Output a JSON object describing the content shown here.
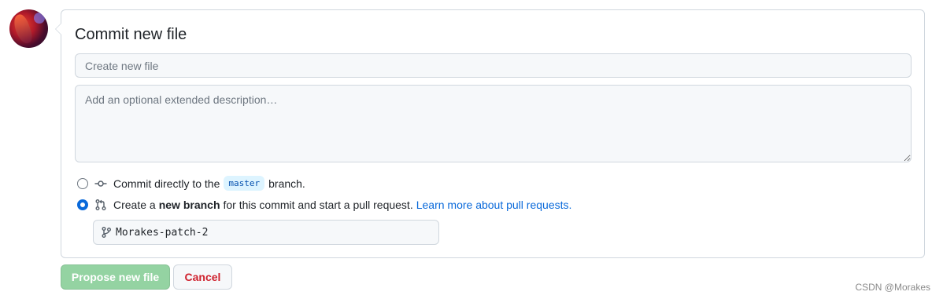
{
  "form": {
    "title": "Commit new file",
    "summary_placeholder": "Create new file",
    "summary_value": "",
    "description_placeholder": "Add an optional extended description…",
    "description_value": ""
  },
  "options": {
    "direct": {
      "prefix": "Commit directly to the",
      "branch": "master",
      "suffix": "branch.",
      "selected": false
    },
    "new_branch": {
      "prefix": "Create a",
      "strong": "new branch",
      "suffix": "for this commit and start a pull request.",
      "link": "Learn more about pull requests.",
      "selected": true
    }
  },
  "branch_input": {
    "value": "Morakes-patch-2"
  },
  "buttons": {
    "propose": "Propose new file",
    "cancel": "Cancel"
  },
  "watermark": "CSDN @Morakes",
  "colors": {
    "accent": "#0969da",
    "propose_bg": "#94d3a2",
    "cancel_text": "#cf222e"
  }
}
